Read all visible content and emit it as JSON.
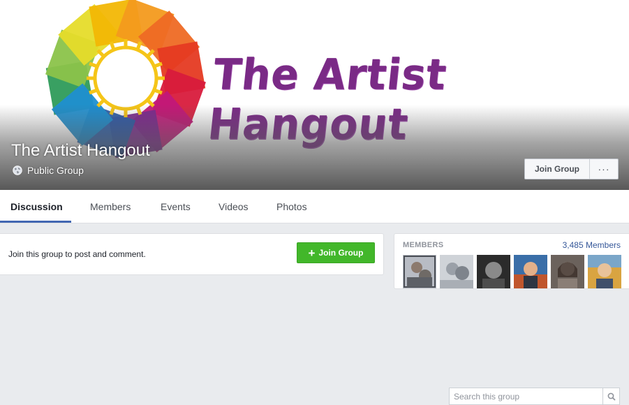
{
  "cover": {
    "banner_text": "The Artist Hangout",
    "group_name": "The Artist Hangout",
    "privacy": "Public Group",
    "privacy_icon": "globe-icon",
    "join_label": "Join Group",
    "more_label": "···"
  },
  "tabs": [
    {
      "label": "Discussion",
      "active": true
    },
    {
      "label": "Members",
      "active": false
    },
    {
      "label": "Events",
      "active": false
    },
    {
      "label": "Videos",
      "active": false
    },
    {
      "label": "Photos",
      "active": false
    }
  ],
  "search": {
    "placeholder": "Search this group",
    "value": "",
    "icon": "search-icon"
  },
  "post_prompt": {
    "text": "Join this group to post and comment.",
    "join_label": "Join Group",
    "plus": "+"
  },
  "members": {
    "label": "MEMBERS",
    "count": "3,485 Members",
    "avatars": [
      "member-1",
      "member-2",
      "member-3",
      "member-4",
      "member-5",
      "member-6"
    ]
  },
  "colors": {
    "brand_blue": "#4267b2",
    "link_blue": "#365899",
    "join_green": "#42b72a",
    "banner_purple": "#7a2a86",
    "page_bg": "#e9ebee"
  }
}
